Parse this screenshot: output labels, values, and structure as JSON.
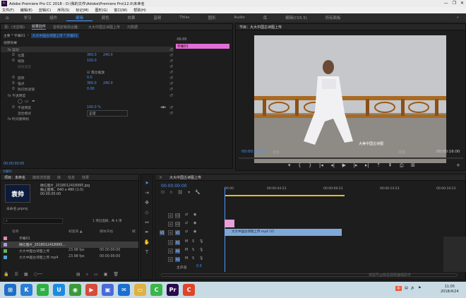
{
  "window": {
    "title": "Adobe Premiere Pro CC 2018 - D:\\我的文件\\Adobe\\Premiere Pro\\12.0\\未命名",
    "controls": [
      "—",
      "❐",
      "✕"
    ]
  },
  "menu": [
    "文件(F)",
    "编辑(E)",
    "剪辑(C)",
    "序列(S)",
    "标记(M)",
    "图形(G)",
    "窗口(W)",
    "帮助(H)"
  ],
  "workspaces": {
    "left_icon": "home-icon",
    "items": [
      "学习",
      "组件",
      "编辑",
      "颜色",
      "效果",
      "音频",
      "Titles",
      "图形",
      "Audio",
      "库",
      "编辑(CS5.5)",
      "所有面板"
    ],
    "active_index": 2,
    "more": "»"
  },
  "effect_controls": {
    "tabs": [
      "源：(无剪辑)",
      "效果控件",
      "音频剪辑混合器：",
      "大大中国古诗图上传",
      "元数据"
    ],
    "active_tab": 1,
    "breadcrumb_master": "主要 * 字幕01",
    "breadcrumb_clip": "大大中国古诗图上传 * 字幕01",
    "section_video": "视频效果",
    "timecode_start": ":00:00",
    "clip_label": "字幕01",
    "rows": [
      {
        "name": "fx 运动",
        "value": "",
        "value2": ""
      },
      {
        "name": "位置",
        "value": "360.0",
        "value2": "240.0"
      },
      {
        "name": "缩放",
        "value": "100.0",
        "value2": ""
      },
      {
        "name": "缩放宽度",
        "value": "",
        "value2": ""
      },
      {
        "name": "",
        "value": "☑ 等比缩放",
        "value2": ""
      },
      {
        "name": "旋转",
        "value": "0.0",
        "value2": ""
      },
      {
        "name": "锚点",
        "value": "360.0",
        "value2": "240.0"
      },
      {
        "name": "防闪烁滤镜",
        "value": "0.00",
        "value2": ""
      },
      {
        "name": "fx 不透明度",
        "value": "",
        "value2": ""
      },
      {
        "name": "",
        "value": "",
        "value2": ""
      },
      {
        "name": "不透明度",
        "value": "100.0 %",
        "value2": ""
      },
      {
        "name": "混合模式",
        "value": "正常",
        "value2": ""
      },
      {
        "name": "fx 时间重映射",
        "value": "",
        "value2": ""
      }
    ],
    "bottom_timecode": "00:00:00:00"
  },
  "program": {
    "tab": "节目：大大中国古诗图上传",
    "subtitle": "大大中国古诗图上传",
    "current_time": "00:00:00:00",
    "fit": "适合",
    "quality": "完整",
    "duration": "00:00:16:00",
    "overlay_text": "大美中国古诗图"
  },
  "project": {
    "tabs": [
      "项目：未命名",
      "媒体浏览器",
      "库",
      "信息",
      "效果"
    ],
    "item_title": "微信图片_2018012418995.jpg",
    "item_meta": "静止图像，640 x 480 (1.0)",
    "item_time": "00:00:05:00",
    "thumb_text": "袁帅",
    "project_name": "未命名.prproj",
    "item_count": "1 项已选择，共 4 项",
    "columns": [
      "名称",
      "帧速率 ▲",
      "媒体开始",
      "媒"
    ],
    "rows": [
      {
        "color": "#e08ab8",
        "name": "字幕01",
        "fps": "",
        "start": ""
      },
      {
        "color": "#b09ad8",
        "name": "微信图片_2018012418995...",
        "fps": "",
        "start": ""
      },
      {
        "color": "#5cb85c",
        "name": "大大中国古诗图上传",
        "fps": "23.98 fps",
        "start": "00:00:00:00"
      },
      {
        "color": "#56a0d6",
        "name": "大大中国古诗图上传.mp4",
        "fps": "23.98 fps",
        "start": "00:00:00:00"
      }
    ]
  },
  "timeline": {
    "tab": "大大中国古诗图上传",
    "current_time": "00:00:00:00",
    "ruler": [
      "00:00",
      "00:00:04:23",
      "00:00:09:23",
      "00:00:14:23",
      "00:00:19:23"
    ],
    "video_tracks": [
      "V3",
      "V2",
      "V1"
    ],
    "audio_tracks": [
      "A1",
      "A2",
      "A3"
    ],
    "video_clip": "大大中国古诗图上传.mp4 [V]",
    "master_label": "主声道",
    "master_value": "0.0"
  },
  "source_strip": {
    "clip": "字幕01"
  },
  "tray": {
    "ime": "中",
    "time": "11:05",
    "date": "2018/4/24",
    "watermark": "搜狐号@我是视频编辑助手"
  },
  "taskbar_icons": [
    {
      "name": "start",
      "color": "#1e6ec8",
      "glyph": "⊞"
    },
    {
      "name": "browser",
      "color": "#2a7fd4",
      "glyph": "K"
    },
    {
      "name": "wechat",
      "color": "#2db143",
      "glyph": "✉"
    },
    {
      "name": "uplayer",
      "color": "#1c8be0",
      "glyph": "U"
    },
    {
      "name": "game",
      "color": "#3a9a3a",
      "glyph": "◉"
    },
    {
      "name": "media",
      "color": "#d84a3a",
      "glyph": "▶"
    },
    {
      "name": "window",
      "color": "#4a6ad8",
      "glyph": "▣"
    },
    {
      "name": "mail",
      "color": "#1a6fd0",
      "glyph": "✉"
    },
    {
      "name": "folder",
      "color": "#e0b040",
      "glyph": "▭"
    },
    {
      "name": "green-c",
      "color": "#3cb54a",
      "glyph": "C"
    },
    {
      "name": "premiere",
      "color": "#2a0a4a",
      "glyph": "Pr"
    },
    {
      "name": "red-c",
      "color": "#e0452a",
      "glyph": "C"
    }
  ]
}
